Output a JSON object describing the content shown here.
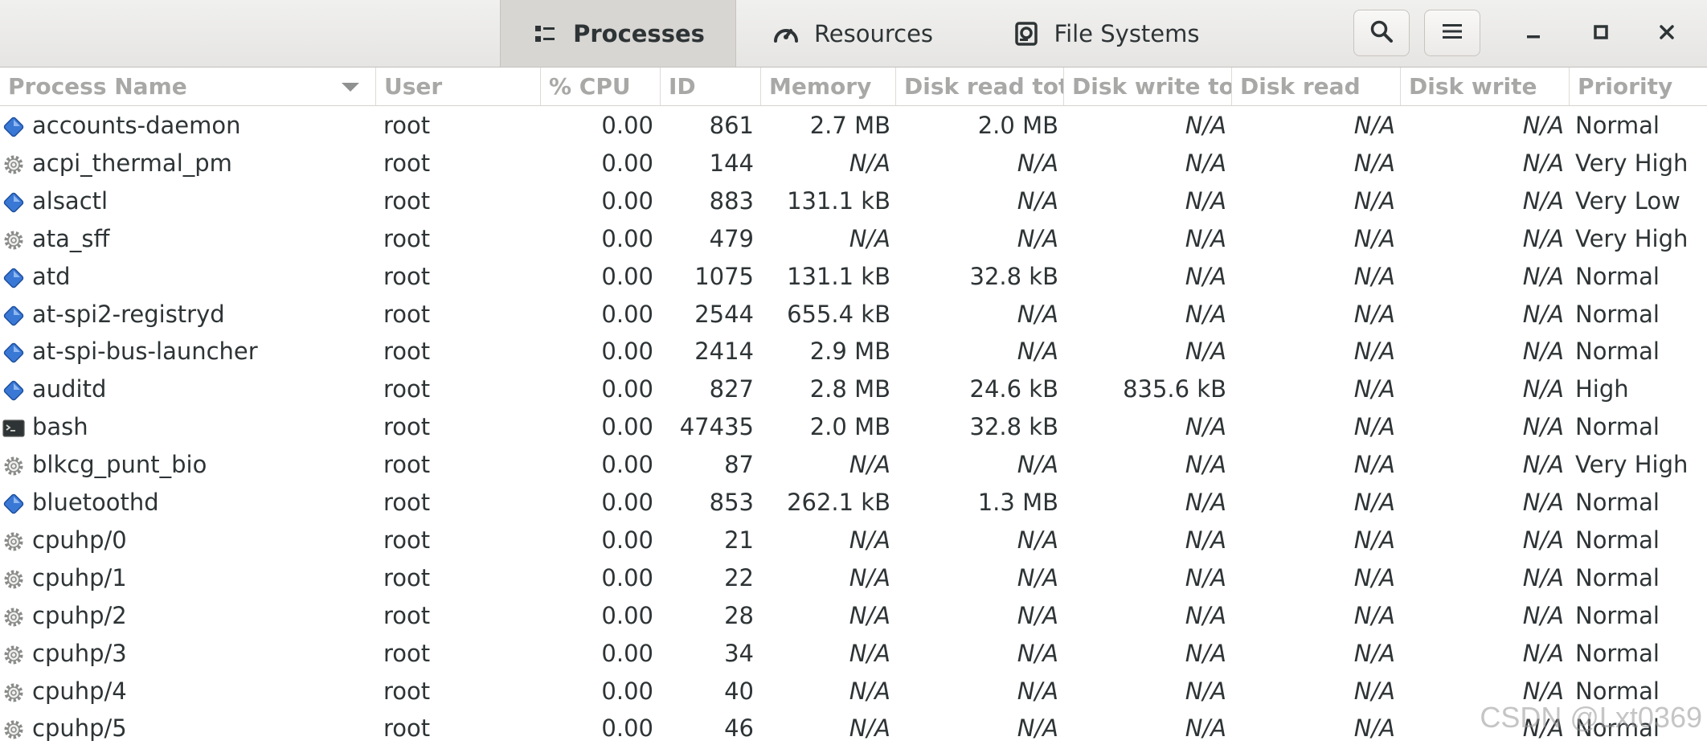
{
  "tabs": [
    {
      "label": "Processes",
      "icon": "list-icon",
      "active": true
    },
    {
      "label": "Resources",
      "icon": "gauge-icon",
      "active": false
    },
    {
      "label": "File Systems",
      "icon": "disk-icon",
      "active": false
    }
  ],
  "header_buttons": {
    "search": "search-icon",
    "menu": "hamburger-menu-icon",
    "minimize": "minimize-icon",
    "maximize": "maximize-icon",
    "close": "close-icon"
  },
  "columns": {
    "name": "Process Name",
    "user": "User",
    "cpu": "% CPU",
    "id": "ID",
    "memory": "Memory",
    "disk_read_total": "Disk read tota",
    "disk_write_total": "Disk write tot",
    "disk_read": "Disk read",
    "disk_write": "Disk write",
    "priority": "Priority"
  },
  "processes": [
    {
      "icon": "app-diamond-icon",
      "name": "accounts-daemon",
      "user": "root",
      "cpu": "0.00",
      "id": "861",
      "memory": "2.7 MB",
      "drt": "2.0 MB",
      "dwt": "N/A",
      "dr": "N/A",
      "dw": "N/A",
      "priority": "Normal"
    },
    {
      "icon": "gear-icon",
      "name": "acpi_thermal_pm",
      "user": "root",
      "cpu": "0.00",
      "id": "144",
      "memory": "N/A",
      "drt": "N/A",
      "dwt": "N/A",
      "dr": "N/A",
      "dw": "N/A",
      "priority": "Very High"
    },
    {
      "icon": "app-diamond-icon",
      "name": "alsactl",
      "user": "root",
      "cpu": "0.00",
      "id": "883",
      "memory": "131.1 kB",
      "drt": "N/A",
      "dwt": "N/A",
      "dr": "N/A",
      "dw": "N/A",
      "priority": "Very Low"
    },
    {
      "icon": "gear-icon",
      "name": "ata_sff",
      "user": "root",
      "cpu": "0.00",
      "id": "479",
      "memory": "N/A",
      "drt": "N/A",
      "dwt": "N/A",
      "dr": "N/A",
      "dw": "N/A",
      "priority": "Very High"
    },
    {
      "icon": "app-diamond-icon",
      "name": "atd",
      "user": "root",
      "cpu": "0.00",
      "id": "1075",
      "memory": "131.1 kB",
      "drt": "32.8 kB",
      "dwt": "N/A",
      "dr": "N/A",
      "dw": "N/A",
      "priority": "Normal"
    },
    {
      "icon": "app-diamond-icon",
      "name": "at-spi2-registryd",
      "user": "root",
      "cpu": "0.00",
      "id": "2544",
      "memory": "655.4 kB",
      "drt": "N/A",
      "dwt": "N/A",
      "dr": "N/A",
      "dw": "N/A",
      "priority": "Normal"
    },
    {
      "icon": "app-diamond-icon",
      "name": "at-spi-bus-launcher",
      "user": "root",
      "cpu": "0.00",
      "id": "2414",
      "memory": "2.9 MB",
      "drt": "N/A",
      "dwt": "N/A",
      "dr": "N/A",
      "dw": "N/A",
      "priority": "Normal"
    },
    {
      "icon": "app-diamond-icon",
      "name": "auditd",
      "user": "root",
      "cpu": "0.00",
      "id": "827",
      "memory": "2.8 MB",
      "drt": "24.6 kB",
      "dwt": "835.6 kB",
      "dr": "N/A",
      "dw": "N/A",
      "priority": "High"
    },
    {
      "icon": "terminal-icon",
      "name": "bash",
      "user": "root",
      "cpu": "0.00",
      "id": "47435",
      "memory": "2.0 MB",
      "drt": "32.8 kB",
      "dwt": "N/A",
      "dr": "N/A",
      "dw": "N/A",
      "priority": "Normal"
    },
    {
      "icon": "gear-icon",
      "name": "blkcg_punt_bio",
      "user": "root",
      "cpu": "0.00",
      "id": "87",
      "memory": "N/A",
      "drt": "N/A",
      "dwt": "N/A",
      "dr": "N/A",
      "dw": "N/A",
      "priority": "Very High"
    },
    {
      "icon": "app-diamond-icon",
      "name": "bluetoothd",
      "user": "root",
      "cpu": "0.00",
      "id": "853",
      "memory": "262.1 kB",
      "drt": "1.3 MB",
      "dwt": "N/A",
      "dr": "N/A",
      "dw": "N/A",
      "priority": "Normal"
    },
    {
      "icon": "gear-icon",
      "name": "cpuhp/0",
      "user": "root",
      "cpu": "0.00",
      "id": "21",
      "memory": "N/A",
      "drt": "N/A",
      "dwt": "N/A",
      "dr": "N/A",
      "dw": "N/A",
      "priority": "Normal"
    },
    {
      "icon": "gear-icon",
      "name": "cpuhp/1",
      "user": "root",
      "cpu": "0.00",
      "id": "22",
      "memory": "N/A",
      "drt": "N/A",
      "dwt": "N/A",
      "dr": "N/A",
      "dw": "N/A",
      "priority": "Normal"
    },
    {
      "icon": "gear-icon",
      "name": "cpuhp/2",
      "user": "root",
      "cpu": "0.00",
      "id": "28",
      "memory": "N/A",
      "drt": "N/A",
      "dwt": "N/A",
      "dr": "N/A",
      "dw": "N/A",
      "priority": "Normal"
    },
    {
      "icon": "gear-icon",
      "name": "cpuhp/3",
      "user": "root",
      "cpu": "0.00",
      "id": "34",
      "memory": "N/A",
      "drt": "N/A",
      "dwt": "N/A",
      "dr": "N/A",
      "dw": "N/A",
      "priority": "Normal"
    },
    {
      "icon": "gear-icon",
      "name": "cpuhp/4",
      "user": "root",
      "cpu": "0.00",
      "id": "40",
      "memory": "N/A",
      "drt": "N/A",
      "dwt": "N/A",
      "dr": "N/A",
      "dw": "N/A",
      "priority": "Normal"
    },
    {
      "icon": "gear-icon",
      "name": "cpuhp/5",
      "user": "root",
      "cpu": "0.00",
      "id": "46",
      "memory": "N/A",
      "drt": "N/A",
      "dwt": "N/A",
      "dr": "N/A",
      "dw": "N/A",
      "priority": "Normal"
    }
  ],
  "watermark": "CSDN @Lxt0369"
}
